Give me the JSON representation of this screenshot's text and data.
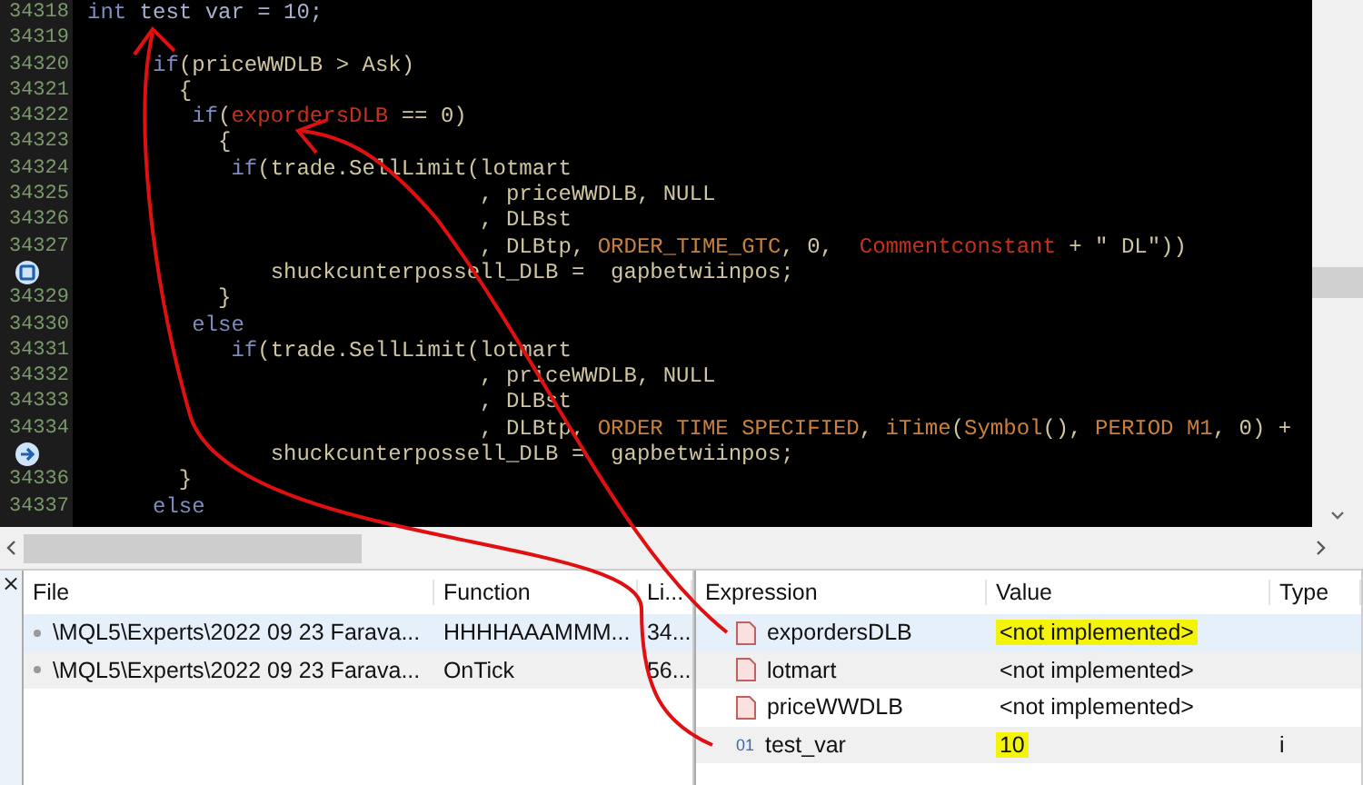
{
  "editor": {
    "lines": [
      {
        "number": "34318",
        "tokens": [
          {
            "text": "int",
            "kind": "keyword"
          },
          {
            "text": " test var = 10;",
            "kind": "plainblue"
          }
        ]
      },
      {
        "number": "34319"
      },
      {
        "number": "34320",
        "tokens": [
          {
            "text": "     if",
            "kind": "keyword"
          },
          {
            "text": "(priceWWDLB > Ask)",
            "kind": "plain"
          }
        ]
      },
      {
        "number": "34321",
        "tokens": [
          {
            "text": "       {",
            "kind": "plain"
          }
        ]
      },
      {
        "number": "34322",
        "tokens": [
          {
            "text": "        if",
            "kind": "keyword"
          },
          {
            "text": "(",
            "kind": "plain"
          },
          {
            "text": "expordersDLB",
            "kind": "variable"
          },
          {
            "text": " == 0)",
            "kind": "plain"
          }
        ]
      },
      {
        "number": "34323",
        "tokens": [
          {
            "text": "          {",
            "kind": "plain"
          }
        ]
      },
      {
        "number": "34324",
        "tokens": [
          {
            "text": "           if",
            "kind": "keyword"
          },
          {
            "text": "(trade.SellLimit(lotmart",
            "kind": "plain"
          }
        ]
      },
      {
        "number": "34325",
        "tokens": [
          {
            "text": "                              , priceWWDLB, NULL",
            "kind": "plain"
          }
        ]
      },
      {
        "number": "34326",
        "tokens": [
          {
            "text": "                              , DLBst",
            "kind": "plain"
          }
        ]
      },
      {
        "number": "34327",
        "tokens": [
          {
            "text": "                              , DLBtp, ",
            "kind": "plain"
          },
          {
            "text": "ORDER_TIME_GTC",
            "kind": "constant"
          },
          {
            "text": ", 0,  ",
            "kind": "plain"
          },
          {
            "text": "Commentconstant",
            "kind": "variable"
          },
          {
            "text": " + \" DL\"))",
            "kind": "plain"
          }
        ]
      },
      {
        "breakpoint": true,
        "tokens": [
          {
            "text": "              shuckcunterpossell_DLB =  gapbetwiinpos;",
            "kind": "plain"
          }
        ]
      },
      {
        "number": "34329",
        "tokens": [
          {
            "text": "          }",
            "kind": "plain"
          }
        ]
      },
      {
        "number": "34330",
        "tokens": [
          {
            "text": "        else",
            "kind": "keyword"
          }
        ]
      },
      {
        "number": "34331",
        "tokens": [
          {
            "text": "           if",
            "kind": "keyword"
          },
          {
            "text": "(trade.SellLimit(lotmart",
            "kind": "plain"
          }
        ]
      },
      {
        "number": "34332",
        "tokens": [
          {
            "text": "                              , priceWWDLB, NULL",
            "kind": "plain"
          }
        ]
      },
      {
        "number": "34333",
        "tokens": [
          {
            "text": "                              , DLBst",
            "kind": "plain"
          }
        ]
      },
      {
        "number": "34334",
        "tokens": [
          {
            "text": "                              , DLBtp, ",
            "kind": "plain"
          },
          {
            "text": "ORDER TIME SPECIFIED",
            "kind": "constant"
          },
          {
            "text": ", ",
            "kind": "plain"
          },
          {
            "text": "iTime",
            "kind": "constant"
          },
          {
            "text": "(",
            "kind": "plain"
          },
          {
            "text": "Symbol",
            "kind": "constant"
          },
          {
            "text": "(), ",
            "kind": "plain"
          },
          {
            "text": "PERIOD M1",
            "kind": "constant"
          },
          {
            "text": ", 0) +",
            "kind": "plain"
          }
        ]
      },
      {
        "execution_point": true,
        "tokens": [
          {
            "text": "              shuckcunterpossell_DLB =  gapbetwiinpos;",
            "kind": "plain"
          }
        ]
      },
      {
        "number": "34336",
        "tokens": [
          {
            "text": "       }",
            "kind": "plain"
          }
        ]
      },
      {
        "number": "34337",
        "tokens": [
          {
            "text": "     else",
            "kind": "keyword"
          }
        ]
      }
    ]
  },
  "panel_close": "×",
  "call_stack": {
    "columns": [
      "File",
      "Function",
      "Li..."
    ],
    "rows": [
      {
        "selected": true,
        "cells": [
          "\\MQL5\\Experts\\2022 09 23 Farava...",
          "HHHHAAAMMM...",
          "34..."
        ]
      },
      {
        "selected": false,
        "cells": [
          "\\MQL5\\Experts\\2022 09 23 Farava...",
          "OnTick",
          "56..."
        ]
      }
    ]
  },
  "watch": {
    "columns": [
      "Expression",
      "Value",
      "Type"
    ],
    "rows": [
      {
        "selected": true,
        "kind": "object",
        "expression": "expordersDLB",
        "value": "<not implemented>",
        "highlighted": true
      },
      {
        "selected": false,
        "kind": "object",
        "expression": "lotmart",
        "value": "<not implemented>",
        "highlighted": false
      },
      {
        "selected": false,
        "kind": "object",
        "expression": "priceWWDLB",
        "value": "<not implemented>",
        "highlighted": false
      },
      {
        "selected": false,
        "kind": "int",
        "icon_text": "01",
        "expression": "test_var",
        "value": "10",
        "highlighted": true,
        "type": "i"
      }
    ]
  }
}
